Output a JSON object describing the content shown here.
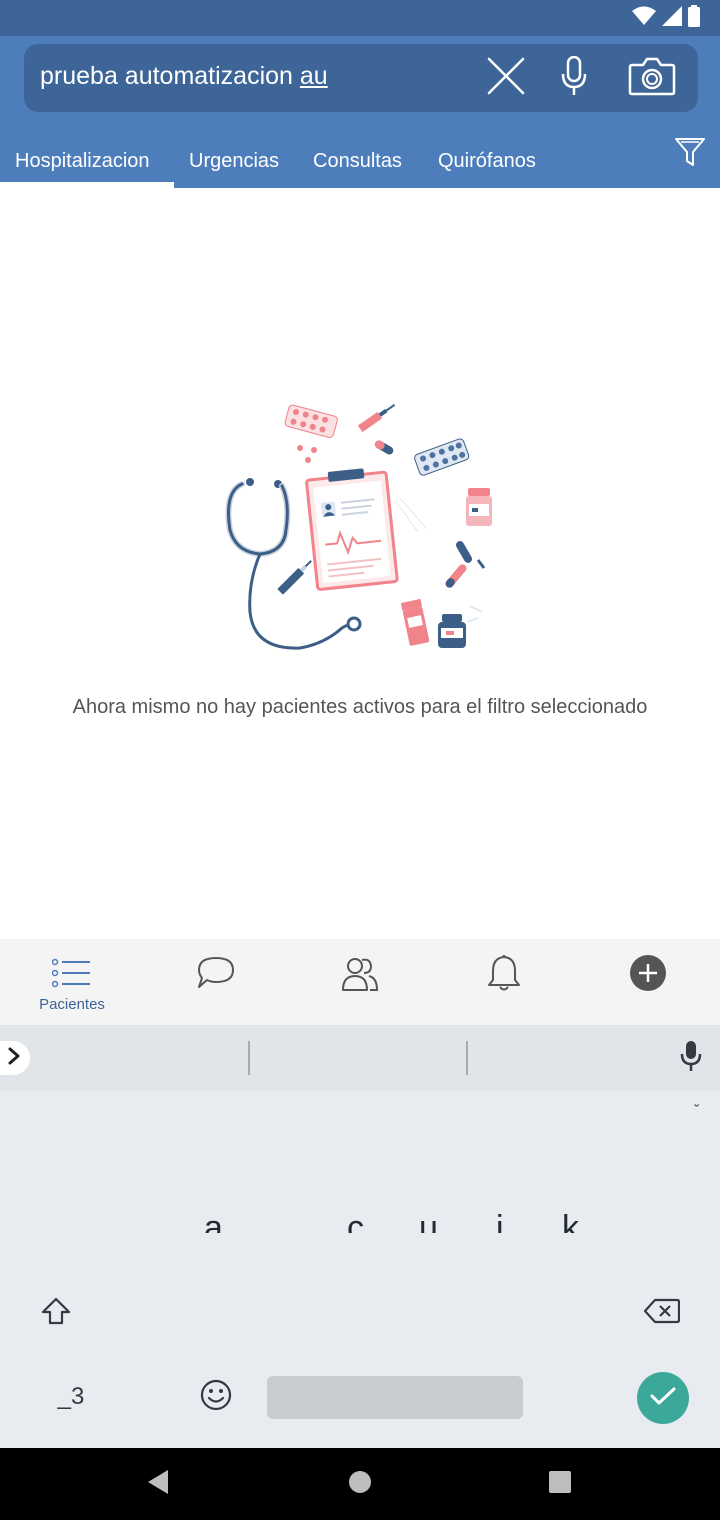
{
  "status_bar": {
    "icons": [
      "wifi-icon",
      "cell-signal-icon",
      "battery-icon"
    ]
  },
  "search": {
    "query": "prueba automatizacion ",
    "composing": "au",
    "actions": [
      "clear-icon",
      "microphone-icon",
      "camera-icon"
    ]
  },
  "tabs": [
    {
      "label": "Hospitalizacion",
      "selected": true
    },
    {
      "label": "Urgencias",
      "selected": false
    },
    {
      "label": "Consultas",
      "selected": false
    },
    {
      "label": "Quirófanos",
      "selected": false
    }
  ],
  "filter": {
    "icon": "filter-icon"
  },
  "empty_state": {
    "illustration": "medical-illustration",
    "message": "Ahora mismo no hay pacientes activos para el filtro seleccionado"
  },
  "bottom_nav": {
    "items": [
      {
        "icon": "patient-list-icon",
        "label": "Pacientes",
        "active": true
      },
      {
        "icon": "chat-bubble-icon",
        "label": ""
      },
      {
        "icon": "team-icon",
        "label": ""
      },
      {
        "icon": "bell-icon",
        "label": ""
      },
      {
        "icon": "add-circle-icon",
        "label": ""
      }
    ]
  },
  "keyboard": {
    "ribbon": "ˇ",
    "letters": [
      "a",
      "c",
      "u",
      "i",
      "k"
    ],
    "symbols_label": "_3",
    "icons": [
      "expand-icon",
      "keyboard-mic-icon",
      "shift-icon",
      "backspace-icon",
      "emoji-icon",
      "done-check-icon"
    ]
  },
  "system_nav": {
    "icons": [
      "back-icon",
      "home-icon",
      "recents-icon"
    ]
  },
  "colors": {
    "status_bar": "#3e6597",
    "header": "#4d7ebb",
    "search_box": "#3e6597",
    "accent_blue": "#3e6597",
    "illustration_pink": "#f1838b",
    "illustration_navy": "#3d5e86",
    "done_key": "#3ba89a"
  }
}
